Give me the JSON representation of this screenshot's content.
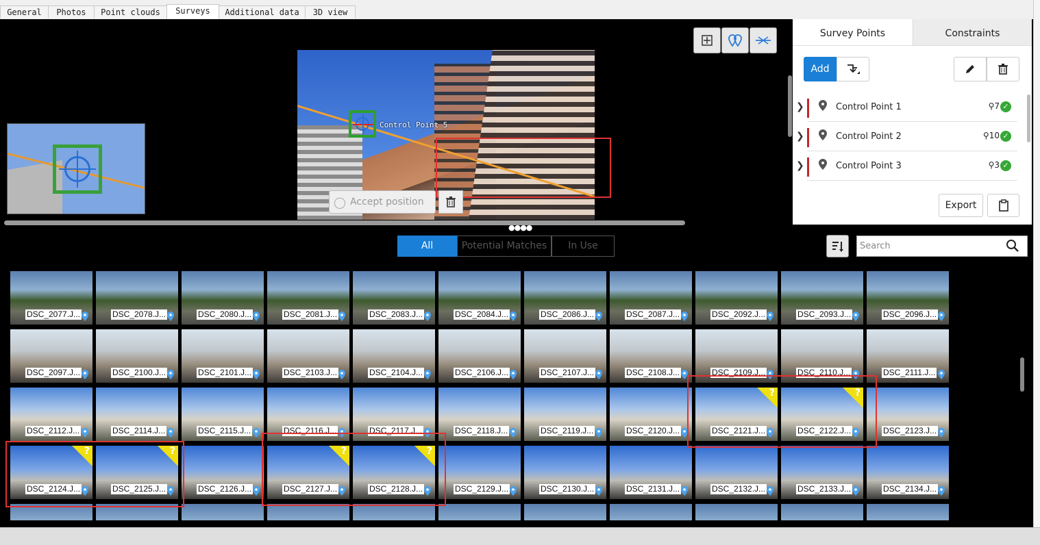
{
  "tabs": [
    {
      "label": "General",
      "active": false
    },
    {
      "label": "Photos",
      "active": false
    },
    {
      "label": "Point clouds",
      "active": false
    },
    {
      "label": "Surveys",
      "active": true
    },
    {
      "label": "Additional data",
      "active": false
    },
    {
      "label": "3D view",
      "active": false
    }
  ],
  "viewer": {
    "point_label": "Control Point 5",
    "accept_label": "Accept position",
    "toolbar_icons": [
      "fit-view-icon",
      "show-points-icon",
      "epipolar-line-icon"
    ]
  },
  "survey_panel": {
    "tabs": [
      "Survey Points",
      "Constraints"
    ],
    "active_tab": "Survey Points",
    "add_label": "Add",
    "export_label": "Export",
    "points": [
      {
        "name": "Control Point 1",
        "count": "7",
        "status": "ok"
      },
      {
        "name": "Control Point 2",
        "count": "10",
        "status": "ok"
      },
      {
        "name": "Control Point 3",
        "count": "3",
        "status": "ok"
      }
    ]
  },
  "filter": {
    "options": [
      "All",
      "Potential Matches",
      "In Use"
    ],
    "active": "All",
    "search_placeholder": "Search"
  },
  "photos": [
    [
      "DSC_2077.J...",
      "DSC_2078.J...",
      "DSC_2080.J...",
      "DSC_2081.J...",
      "DSC_2083.J...",
      "DSC_2084.J...",
      "DSC_2086.J...",
      "DSC_2087.J...",
      "DSC_2092.J...",
      "DSC_2093.J...",
      "DSC_2096.J..."
    ],
    [
      "DSC_2097.J...",
      "DSC_2100.J...",
      "DSC_2101.J...",
      "DSC_2103.J...",
      "DSC_2104.J...",
      "DSC_2106.J...",
      "DSC_2107.J...",
      "DSC_2108.J...",
      "DSC_2109.J...",
      "DSC_2110.J...",
      "DSC_2111.J..."
    ],
    [
      "DSC_2112.J...",
      "DSC_2114.J...",
      "DSC_2115.J...",
      "DSC_2116.J...",
      "DSC_2117.J...",
      "DSC_2118.J...",
      "DSC_2119.J...",
      "DSC_2120.J...",
      "DSC_2121.J...",
      "DSC_2122.J...",
      "DSC_2123.J..."
    ],
    [
      "DSC_2124.J...",
      "DSC_2125.J...",
      "DSC_2126.J...",
      "DSC_2127.J...",
      "DSC_2128.J...",
      "DSC_2129.J...",
      "DSC_2130.J...",
      "DSC_2131.J...",
      "DSC_2132.J...",
      "DSC_2133.J...",
      "DSC_2134.J..."
    ],
    [
      "",
      "",
      "",
      "",
      "",
      "",
      "",
      "",
      "",
      "",
      ""
    ]
  ],
  "potential_match_photos": [
    "DSC_2121.J...",
    "DSC_2122.J...",
    "DSC_2124.J...",
    "DSC_2125.J...",
    "DSC_2127.J...",
    "DSC_2128.J..."
  ],
  "colors": {
    "accent": "#1a7fd6",
    "point_bar": "#c0262d",
    "ok": "#35a835",
    "highlight": "#e03232",
    "match_badge": "#f0e010"
  }
}
